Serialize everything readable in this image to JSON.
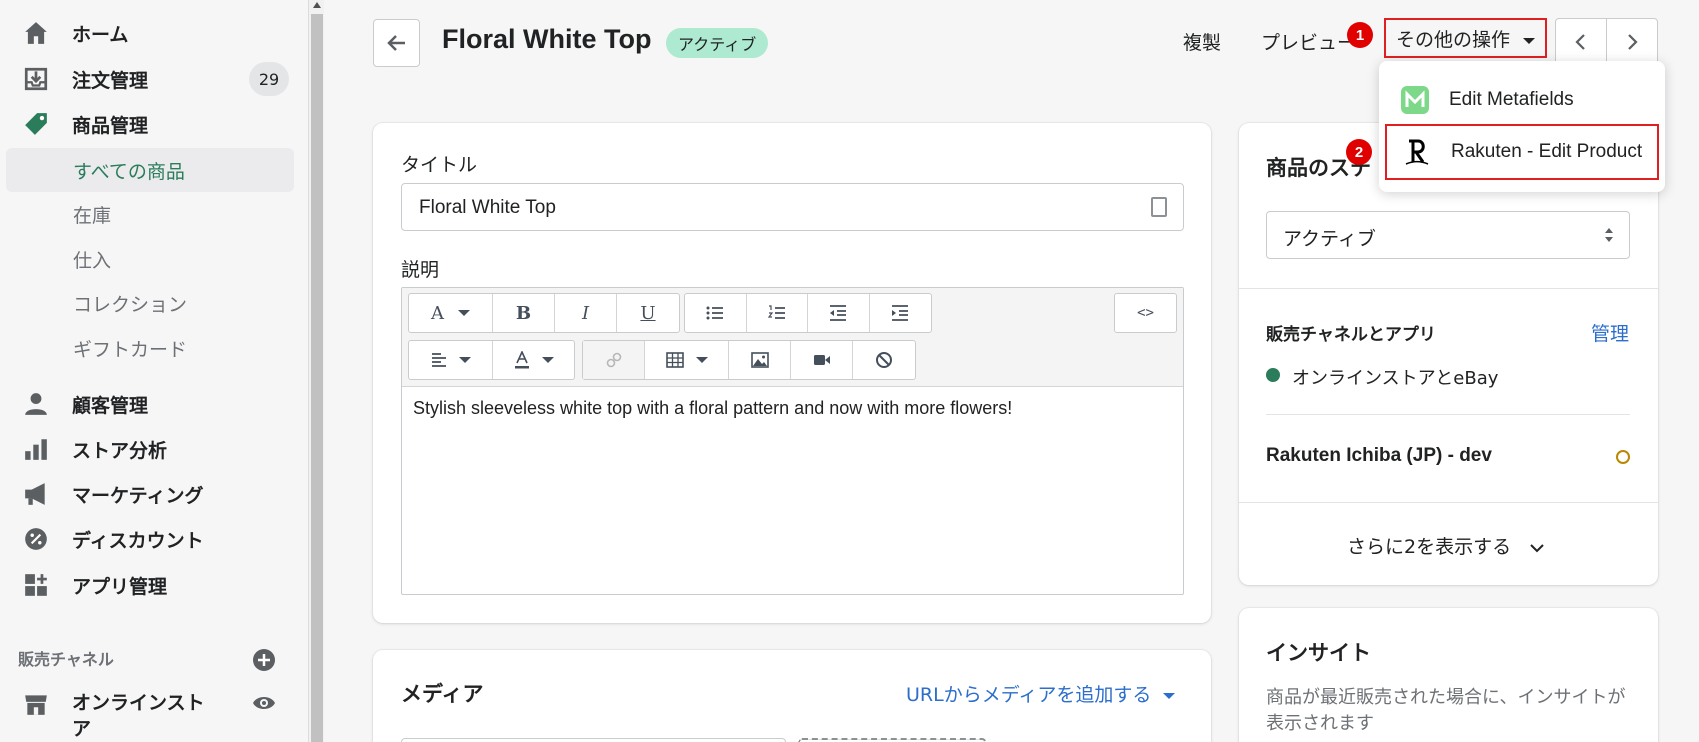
{
  "sidebar": {
    "items": [
      {
        "label": "ホーム",
        "icon": "home-icon"
      },
      {
        "label": "注文管理",
        "icon": "orders-icon",
        "badge": "29"
      },
      {
        "label": "商品管理",
        "icon": "tag-icon"
      }
    ],
    "product_sub": [
      {
        "label": "すべての商品",
        "selected": true
      },
      {
        "label": "在庫"
      },
      {
        "label": "仕入"
      },
      {
        "label": "コレクション"
      },
      {
        "label": "ギフトカード"
      }
    ],
    "items2": [
      {
        "label": "顧客管理",
        "icon": "customer-icon"
      },
      {
        "label": "ストア分析",
        "icon": "analytics-icon"
      },
      {
        "label": "マーケティング",
        "icon": "megaphone-icon"
      },
      {
        "label": "ディスカウント",
        "icon": "discount-icon"
      },
      {
        "label": "アプリ管理",
        "icon": "apps-icon"
      }
    ],
    "channels_label": "販売チャネル",
    "online_store": "オンラインスト\nア"
  },
  "header": {
    "title": "Floral White Top",
    "status": "アクティブ",
    "duplicate": "複製",
    "preview": "プレビュー",
    "more_actions": "その他の操作"
  },
  "markers": [
    "1",
    "2"
  ],
  "dropdown": {
    "items": [
      {
        "label": "Edit Metafields",
        "icon": "metafields-app-icon"
      },
      {
        "label": "Rakuten - Edit Product",
        "icon": "rakuten-icon"
      }
    ]
  },
  "product_form": {
    "title_label": "タイトル",
    "title_value": "Floral White Top",
    "description_label": "説明",
    "description_text": "Stylish sleeveless white top with a floral pattern and now with more flowers!",
    "toolbar": {
      "font": "A",
      "bold": "B",
      "italic": "I",
      "underline": "U",
      "html": "<>"
    }
  },
  "media": {
    "title": "メディア",
    "add_from_url": "URLからメディアを追加する"
  },
  "status_card": {
    "title": "商品のステ",
    "status_value": "アクティブ",
    "channels_title": "販売チャネルとアプリ",
    "manage": "管理",
    "channel1": "オンラインストアとeBay",
    "channel2": "Rakuten Ichiba (JP) - dev",
    "show_more": "さらに2を表示する"
  },
  "insights": {
    "title": "インサイト",
    "text": "商品が最近販売された場合に、インサイトが表示されます"
  },
  "colors": {
    "accent_green": "#2a7c5b",
    "link_blue": "#2c6ecb",
    "active_badge": "#aee9d1",
    "highlight_red": "#e02020"
  }
}
